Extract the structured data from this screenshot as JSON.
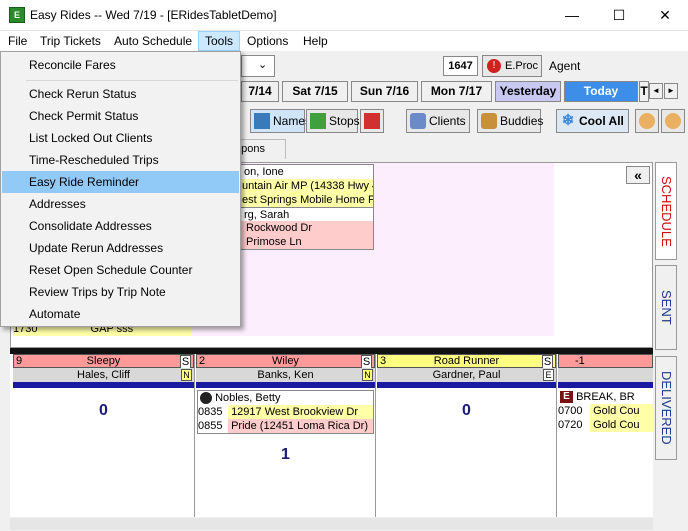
{
  "window": {
    "title": "Easy Rides -- Wed 7/19 - [ERidesTabletDemo]",
    "app_icon_text": "E",
    "minimize": "—",
    "maximize": "☐",
    "close": "✕"
  },
  "menubar": {
    "items": [
      "File",
      "Trip Tickets",
      "Auto Schedule",
      "Tools",
      "Options",
      "Help"
    ]
  },
  "tools_menu": {
    "items": [
      "Reconcile Fares",
      "Check Rerun Status",
      "Check Permit Status",
      "List Locked Out Clients",
      "Time-Rescheduled Trips",
      "Easy Ride Reminder",
      "Addresses",
      "Consolidate Addresses",
      "Update Rerun Addresses",
      "Reset Open Schedule Counter",
      "Review Trips by Trip Note",
      "Automate"
    ],
    "highlighted": "Easy Ride Reminder"
  },
  "toolbar": {
    "counter": "1647",
    "eproc": "E.Proc",
    "agent": "Agent"
  },
  "dates": {
    "items": [
      "7/14",
      "Sat 7/15",
      "Sun 7/16",
      "Mon 7/17",
      "Yesterday",
      "Today",
      "T"
    ],
    "prev": "◄",
    "next": "►"
  },
  "toolbar2": {
    "names": "Names",
    "stops": "Stops",
    "clients": "Clients",
    "buddies": "Buddies",
    "cool_all": "Cool All"
  },
  "tabs": {
    "coupons": "upons"
  },
  "grid_top": {
    "rows": [
      {
        "text": "on, Ione",
        "bg": "#ffffff"
      },
      {
        "text": "untain Air MP (14338 Hwy 4",
        "bg": "#ffffa8"
      },
      {
        "text": "est Springs Mobile Home Pa",
        "bg": "#ffffa8"
      },
      {
        "text": "rg, Sarah",
        "bg": "#ffffff"
      },
      {
        "text": "Rockwood Dr",
        "bg": "#ffcccc"
      },
      {
        "text": "Primose Ln",
        "bg": "#ffcccc"
      }
    ],
    "left_time": "1730",
    "left_text": "GAP sss",
    "collapse": "«"
  },
  "drivers": [
    {
      "num": "9",
      "name": "Sleepy",
      "flag": "S",
      "driver": "Hales, Cliff",
      "flag2": "N",
      "count": "0",
      "head_bg": "#ff9a9a"
    },
    {
      "num": "2",
      "name": "Wiley",
      "flag": "S",
      "driver": "Banks, Ken",
      "flag2": "N",
      "count": "1",
      "head_bg": "#ff9a9a"
    },
    {
      "num": "3",
      "name": "Road Runner",
      "flag": "S",
      "driver": "Gardner, Paul",
      "flag2": "E",
      "count": "0",
      "head_bg": "#ffff80"
    },
    {
      "num": "-1",
      "name": "",
      "flag": "",
      "driver": "",
      "flag2": "",
      "count": "",
      "head_bg": "#ff9a9a"
    }
  ],
  "driver_trips": {
    "wiley_client": "Nobles, Betty",
    "wiley_trips": [
      {
        "time": "0835",
        "addr": "12917 West Brookview Dr",
        "bg": "#ffffa8"
      },
      {
        "time": "0855",
        "addr": "Pride (12451 Loma Rica Dr)",
        "bg": "#ffcccc"
      }
    ],
    "last_client": "BREAK, BR",
    "last_trips": [
      {
        "time": "0700",
        "addr": "Gold Cou",
        "bg": "#ffffa8"
      },
      {
        "time": "0720",
        "addr": "Gold Cou",
        "bg": "#ffffa8"
      }
    ]
  },
  "side_tabs": {
    "schedule": "SCHEDULE",
    "sent": "SENT",
    "delivered": "DELIVERED"
  },
  "colors": {
    "accent_blue": "#3c8ee8",
    "highlight": "#91c9f7",
    "schedule_red": "#d01010"
  }
}
